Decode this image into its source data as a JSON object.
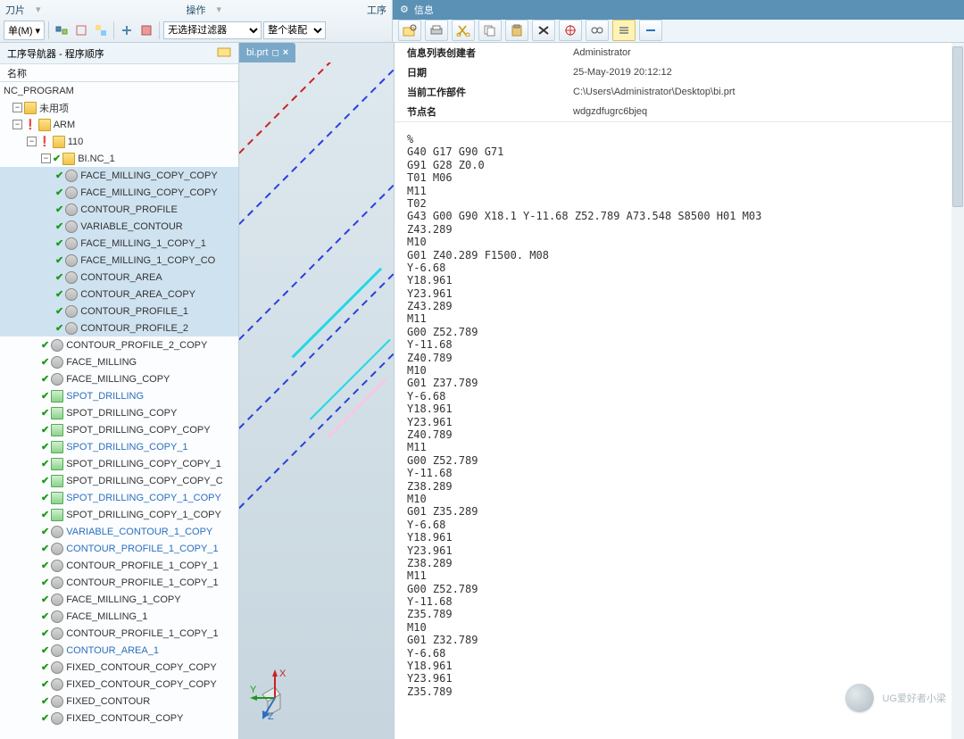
{
  "top": {
    "menu_left1": "刀片",
    "menu_left2": "操作",
    "menu_left3": "工序",
    "menu_btn": "单(M) ▾",
    "filter_sel": "无选择过滤器",
    "assembly_sel": "整个装配",
    "info_hdr": "信息"
  },
  "nav": {
    "title": "工序导航器 - 程序顺序",
    "col": "名称",
    "nc": "NC_PROGRAM",
    "unused": "未用项",
    "arm": "ARM",
    "g110": "110",
    "binc": "BI.NC_1"
  },
  "ops": [
    {
      "t": "FACE_MILLING_COPY_COPY",
      "sel": true
    },
    {
      "t": "FACE_MILLING_COPY_COPY",
      "sel": true
    },
    {
      "t": "CONTOUR_PROFILE",
      "sel": true
    },
    {
      "t": "VARIABLE_CONTOUR",
      "sel": true
    },
    {
      "t": "FACE_MILLING_1_COPY_1",
      "sel": true
    },
    {
      "t": "FACE_MILLING_1_COPY_CO",
      "sel": true
    },
    {
      "t": "CONTOUR_AREA",
      "sel": true
    },
    {
      "t": "CONTOUR_AREA_COPY",
      "sel": true
    },
    {
      "t": "CONTOUR_PROFILE_1",
      "sel": true
    },
    {
      "t": "CONTOUR_PROFILE_2",
      "sel": true
    },
    {
      "t": "CONTOUR_PROFILE_2_COPY",
      "sel": false
    },
    {
      "t": "FACE_MILLING",
      "sel": false
    },
    {
      "t": "FACE_MILLING_COPY",
      "sel": false
    },
    {
      "t": "SPOT_DRILLING",
      "sel": false,
      "blue": true,
      "drill": true
    },
    {
      "t": "SPOT_DRILLING_COPY",
      "sel": false,
      "drill": true
    },
    {
      "t": "SPOT_DRILLING_COPY_COPY",
      "sel": false,
      "drill": true
    },
    {
      "t": "SPOT_DRILLING_COPY_1",
      "sel": false,
      "blue": true,
      "drill": true
    },
    {
      "t": "SPOT_DRILLING_COPY_COPY_1",
      "sel": false,
      "drill": true
    },
    {
      "t": "SPOT_DRILLING_COPY_COPY_C",
      "sel": false,
      "drill": true
    },
    {
      "t": "SPOT_DRILLING_COPY_1_COPY",
      "sel": false,
      "blue": true,
      "drill": true
    },
    {
      "t": "SPOT_DRILLING_COPY_1_COPY",
      "sel": false,
      "drill": true
    },
    {
      "t": "VARIABLE_CONTOUR_1_COPY",
      "sel": false,
      "blue": true
    },
    {
      "t": "CONTOUR_PROFILE_1_COPY_1",
      "sel": false,
      "blue": true
    },
    {
      "t": "CONTOUR_PROFILE_1_COPY_1",
      "sel": false
    },
    {
      "t": "CONTOUR_PROFILE_1_COPY_1",
      "sel": false
    },
    {
      "t": "FACE_MILLING_1_COPY",
      "sel": false
    },
    {
      "t": "FACE_MILLING_1",
      "sel": false
    },
    {
      "t": "CONTOUR_PROFILE_1_COPY_1",
      "sel": false
    },
    {
      "t": "CONTOUR_AREA_1",
      "sel": false,
      "blue": true
    },
    {
      "t": "FIXED_CONTOUR_COPY_COPY",
      "sel": false
    },
    {
      "t": "FIXED_CONTOUR_COPY_COPY",
      "sel": false
    },
    {
      "t": "FIXED_CONTOUR",
      "sel": false
    },
    {
      "t": "FIXED_CONTOUR_COPY",
      "sel": false
    }
  ],
  "file_tab": "bi.prt",
  "meta": [
    {
      "k": "信息列表创建者",
      "v": "Administrator"
    },
    {
      "k": "日期",
      "v": "25-May-2019 20:12:12"
    },
    {
      "k": "当前工作部件",
      "v": "C:\\Users\\Administrator\\Desktop\\bi.prt"
    },
    {
      "k": "节点名",
      "v": "wdgzdfugrc6bjeq"
    }
  ],
  "gcode": "%\nG40 G17 G90 G71\nG91 G28 Z0.0\nT01 M06\nM11\nT02\nG43 G00 G90 X18.1 Y-11.68 Z52.789 A73.548 S8500 H01 M03\nZ43.289\nM10\nG01 Z40.289 F1500. M08\nY-6.68\nY18.961\nY23.961\nZ43.289\nM11\nG00 Z52.789\nY-11.68\nZ40.789\nM10\nG01 Z37.789\nY-6.68\nY18.961\nY23.961\nZ40.789\nM11\nG00 Z52.789\nY-11.68\nZ38.289\nM10\nG01 Z35.289\nY-6.68\nY18.961\nY23.961\nZ38.289\nM11\nG00 Z52.789\nY-11.68\nZ35.789\nM10\nG01 Z32.789\nY-6.68\nY18.961\nY23.961\nZ35.789",
  "watermark": "UG爱好者小梁"
}
